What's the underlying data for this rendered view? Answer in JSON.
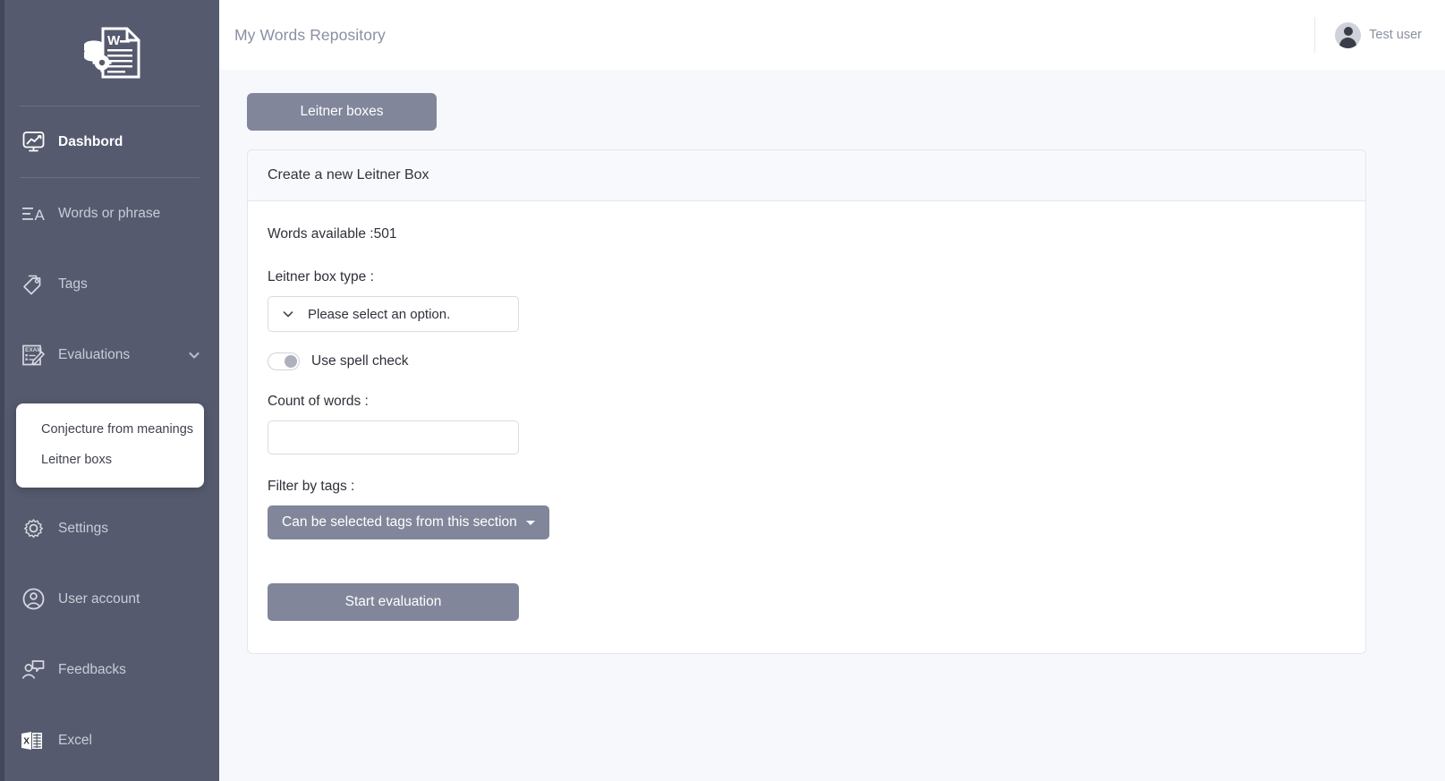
{
  "sidebar": {
    "logo_icon": "word-document-database-gear-icon",
    "items": [
      {
        "label": "Dashbord",
        "icon": "monitor-chart-icon",
        "active": true,
        "has_chevron": false
      },
      {
        "label": "Words or phrase",
        "icon": "text-lines-letter-a-icon",
        "active": false,
        "has_chevron": false
      },
      {
        "label": "Tags",
        "icon": "tags-icon",
        "active": false,
        "has_chevron": false
      },
      {
        "label": "Evaluations",
        "icon": "exam-paper-pencil-icon",
        "active": false,
        "has_chevron": true
      },
      {
        "label": "Settings",
        "icon": "gear-icon",
        "active": false,
        "has_chevron": false
      },
      {
        "label": "User account",
        "icon": "user-circle-icon",
        "active": false,
        "has_chevron": false
      },
      {
        "label": "Feedbacks",
        "icon": "user-speech-bubble-icon",
        "active": false,
        "has_chevron": false
      },
      {
        "label": "Excel",
        "icon": "excel-file-icon",
        "active": false,
        "has_chevron": false
      }
    ],
    "submenu": {
      "items": [
        {
          "label": "Conjecture from meanings"
        },
        {
          "label": "Leitner boxs"
        }
      ]
    }
  },
  "header": {
    "title": "My Words Repository",
    "user": {
      "name": "Test user",
      "avatar_icon": "user-avatar-icon"
    }
  },
  "main": {
    "tab_button": "Leitner boxes",
    "card": {
      "title": "Create a new Leitner Box",
      "words_available": "Words available :501",
      "box_type_label": "Leitner box type :",
      "box_type_select": {
        "value": "Please select an option.",
        "chevron_icon": "chevron-down-icon"
      },
      "spell_check": {
        "label": "Use spell check",
        "enabled": false
      },
      "count_of_words_label": "Count of words :",
      "count_of_words_value": "",
      "count_of_words_placeholder": "",
      "filter_by_tags_label": "Filter by tags :",
      "tags_dropdown_label": "Can be selected tags from this section",
      "start_button": "Start evaluation"
    }
  },
  "colors": {
    "sidebar_bg": "#565a6e",
    "sidebar_edge": "#43475a",
    "accent_button": "#82869a",
    "page_bg": "#f7f8fc",
    "card_header_bg": "#f8f9fc",
    "border": "#e4e6f0",
    "muted_text": "#8a8fa3"
  }
}
